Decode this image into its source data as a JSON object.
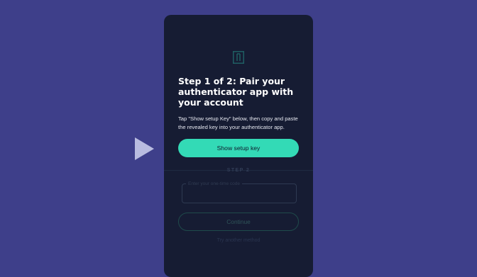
{
  "colors": {
    "background": "#3e3f8a",
    "card": "#161c33",
    "accent": "#33dab6",
    "play": "#b9bce0"
  },
  "player": {
    "icon": "play-icon"
  },
  "card": {
    "logo_icon": "logo-icon",
    "title": "Step 1 of 2: Pair your authenticator app with your account",
    "instructions": "Tap \"Show setup Key\" below, then copy and paste the revealed key into your authenticator app.",
    "show_key_button": "Show setup key",
    "step2_label": "STEP 2",
    "code_field": {
      "label": "Enter your one-time code",
      "value": ""
    },
    "continue_button": "Continue",
    "alt_method_link": "Try another method"
  }
}
